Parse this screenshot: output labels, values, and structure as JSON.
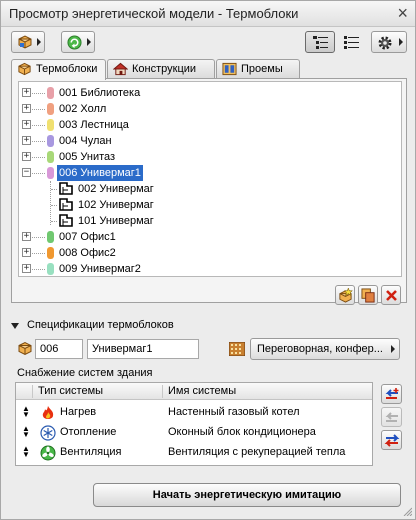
{
  "window": {
    "title": "Просмотр энергетической модели - Термоблоки"
  },
  "tabs": [
    {
      "label": "Термоблоки",
      "icon": "thermoblock-icon",
      "active": true
    },
    {
      "label": "Конструкции",
      "icon": "house-icon",
      "active": false
    },
    {
      "label": "Проемы",
      "icon": "window-opening-icon",
      "active": false
    }
  ],
  "tree": {
    "items": [
      {
        "label": "001 Библиотека",
        "color": "#e8a0a8",
        "expander": "+"
      },
      {
        "label": "002 Холл",
        "color": "#f0a080",
        "expander": "+"
      },
      {
        "label": "003 Лестница",
        "color": "#f0e070",
        "expander": "+"
      },
      {
        "label": "004 Чулан",
        "color": "#a898e0",
        "expander": "+"
      },
      {
        "label": "005 Унитаз",
        "color": "#a8d878",
        "expander": "+"
      },
      {
        "label": "006 Универмаг1",
        "color": "#d898d8",
        "expander": "−",
        "selected": true
      },
      {
        "label": "002 Универмаг",
        "child": true
      },
      {
        "label": "102 Универмаг",
        "child": true
      },
      {
        "label": "101 Универмаг",
        "child": true
      },
      {
        "label": "007 Офис1",
        "color": "#70c870",
        "expander": "+"
      },
      {
        "label": "008 Офис2",
        "color": "#f09830",
        "expander": "+"
      },
      {
        "label": "009 Универмаг2",
        "color": "#98e0c0",
        "expander": "+"
      }
    ]
  },
  "spec": {
    "header": "Спецификации термоблоков",
    "id_value": "006",
    "name_value": "Универмаг1",
    "operation_profile": "Переговорная, конфер..."
  },
  "supply": {
    "label": "Снабжение систем здания",
    "columns": {
      "type": "Тип системы",
      "name": "Имя системы"
    },
    "rows": [
      {
        "type": "Нагрев",
        "name": "Настенный газовый котел",
        "icon": "flame-icon"
      },
      {
        "type": "Отопление",
        "name": "Оконный блок кондиционера",
        "icon": "snowflake-icon"
      },
      {
        "type": "Вентиляция",
        "name": "Вентиляция с рекуперацией тепла",
        "icon": "ventilation-icon"
      }
    ]
  },
  "actions": {
    "start_simulation": "Начать энергетическую  имитацию"
  }
}
